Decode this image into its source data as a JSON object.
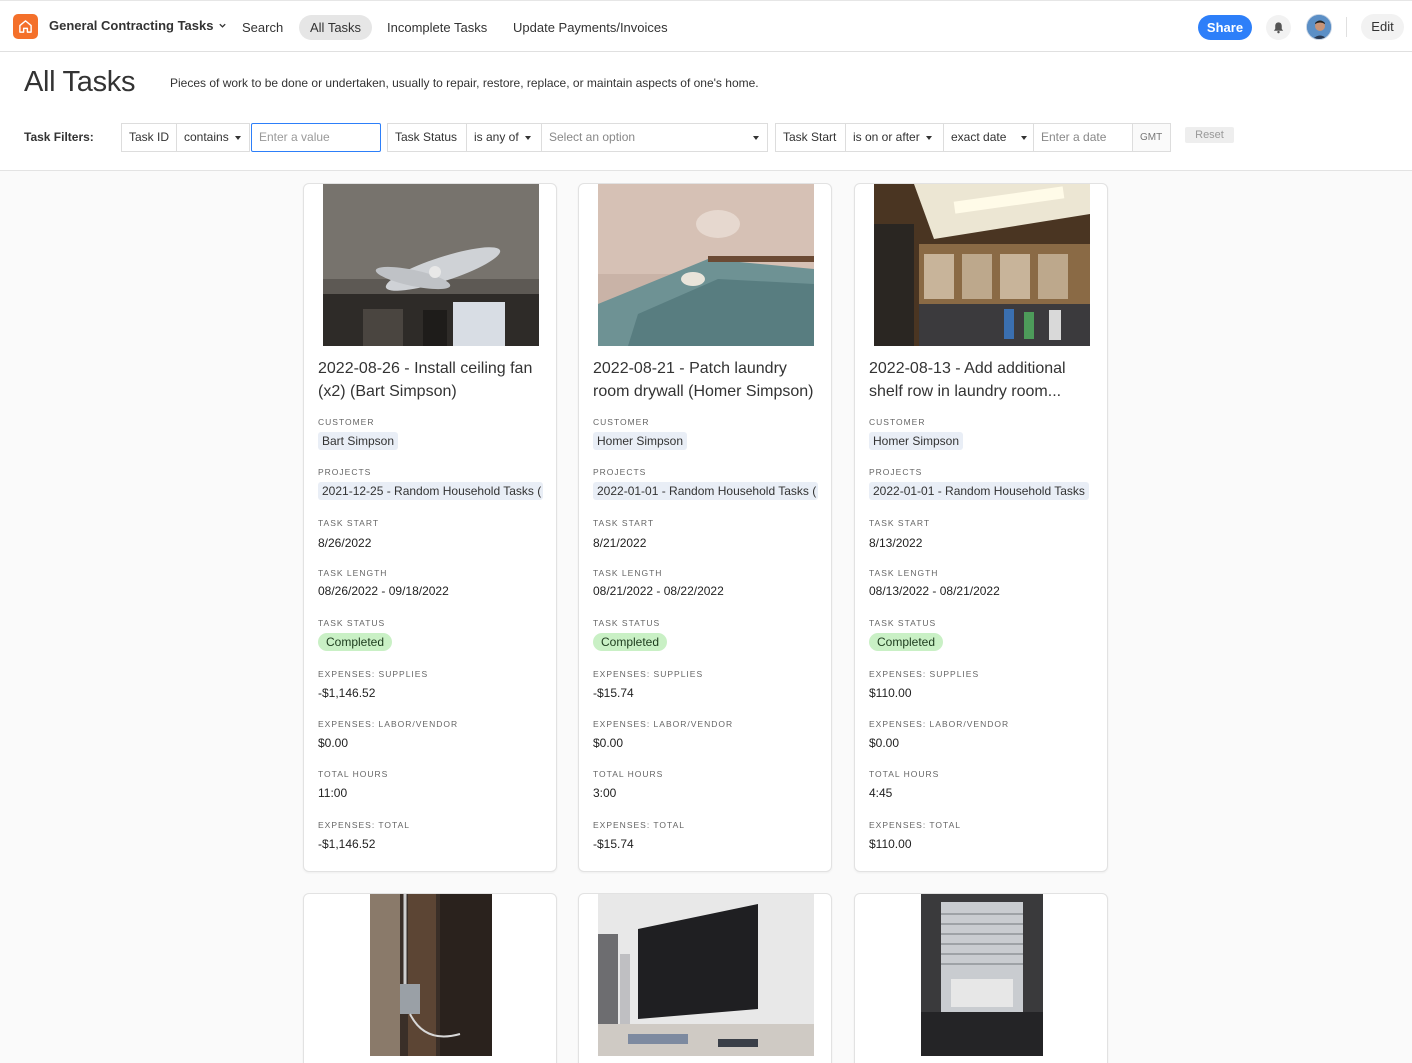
{
  "app": {
    "name": "General Contracting Tasks"
  },
  "nav": {
    "items": [
      {
        "label": "Search"
      },
      {
        "label": "All Tasks"
      },
      {
        "label": "Incomplete Tasks"
      },
      {
        "label": "Update Payments/Invoices"
      }
    ],
    "share_label": "Share",
    "edit_label": "Edit"
  },
  "page": {
    "title": "All Tasks",
    "description": "Pieces of work to be done or undertaken, usually to repair, restore, replace, or maintain aspects of one's home."
  },
  "filters": {
    "label": "Task Filters:",
    "task_id": {
      "field": "Task ID",
      "operator": "contains",
      "placeholder": "Enter a value"
    },
    "task_status": {
      "field": "Task Status",
      "operator": "is any of",
      "placeholder": "Select an option"
    },
    "task_start": {
      "field": "Task Start",
      "operator": "is on or after",
      "mode": "exact date",
      "placeholder": "Enter a date",
      "tz": "GMT"
    },
    "reset_label": "Reset"
  },
  "field_labels": {
    "customer": "CUSTOMER",
    "projects": "PROJECTS",
    "task_start": "TASK START",
    "task_length": "TASK LENGTH",
    "task_status": "TASK STATUS",
    "supplies": "EXPENSES: SUPPLIES",
    "labor": "EXPENSES: LABOR/VENDOR",
    "hours": "TOTAL HOURS",
    "total": "EXPENSES: TOTAL"
  },
  "cards": [
    {
      "title": "2022-08-26 - Install ceiling fan (x2) (Bart Simpson)",
      "customer": "Bart Simpson",
      "project": "2021-12-25 - Random Household Tasks (",
      "task_start": "8/26/2022",
      "task_length": "08/26/2022 - 09/18/2022",
      "status": "Completed",
      "supplies": "-$1,146.52",
      "labor": "$0.00",
      "hours": "11:00",
      "total": "-$1,146.52"
    },
    {
      "title": "2022-08-21 - Patch laundry room drywall (Homer Simpson)",
      "customer": "Homer Simpson",
      "project": "2022-01-01 - Random Household Tasks (",
      "task_start": "8/21/2022",
      "task_length": "08/21/2022 - 08/22/2022",
      "status": "Completed",
      "supplies": "-$15.74",
      "labor": "$0.00",
      "hours": "3:00",
      "total": "-$15.74"
    },
    {
      "title": "2022-08-13 - Add additional shelf row in laundry room...",
      "customer": "Homer Simpson",
      "project": "2022-01-01 - Random Household Tasks",
      "task_start": "8/13/2022",
      "task_length": "08/13/2022 - 08/21/2022",
      "status": "Completed",
      "supplies": "$110.00",
      "labor": "$0.00",
      "hours": "4:45",
      "total": "$110.00"
    }
  ]
}
